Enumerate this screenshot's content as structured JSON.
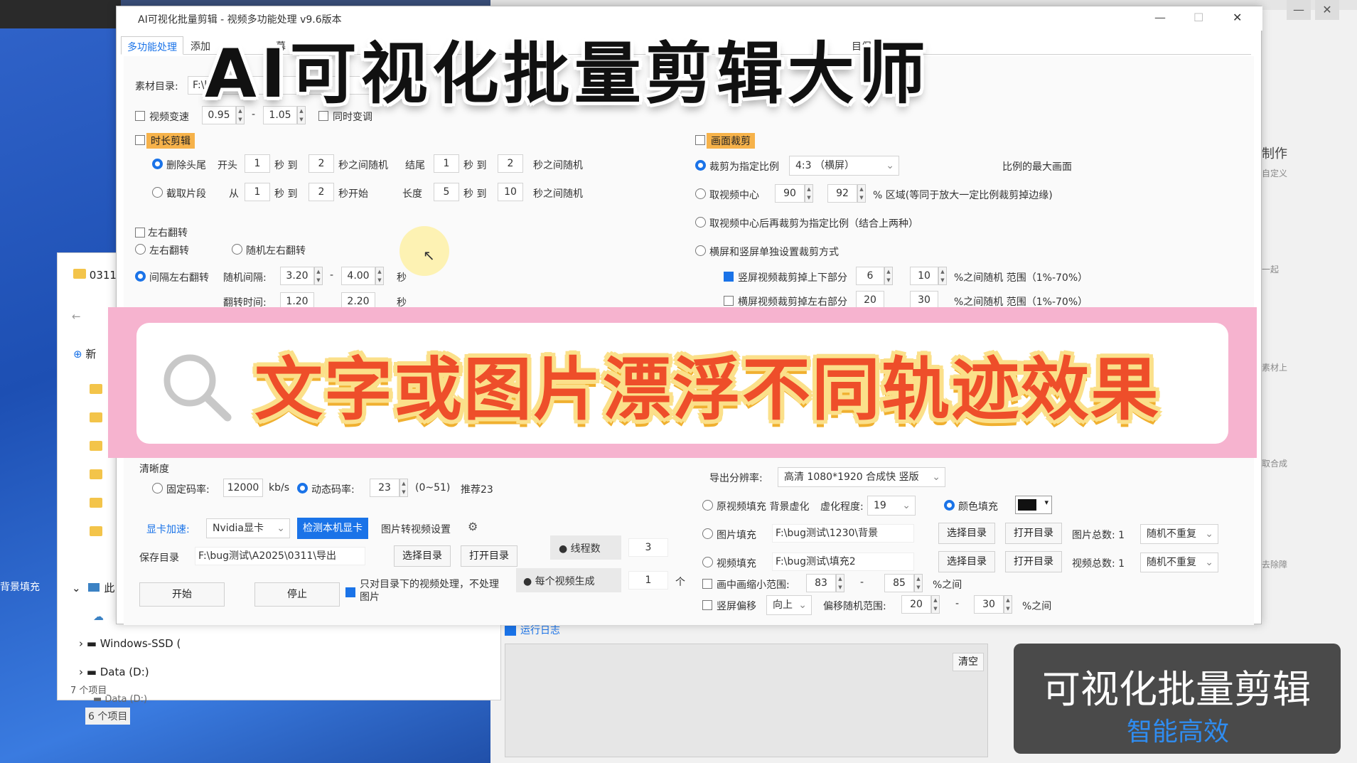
{
  "window": {
    "title": "AI可视化批量剪辑 - 视频多功能处理 v9.6版本",
    "minimize": "—",
    "maximize": "☐",
    "close": "✕"
  },
  "tabs": [
    "多功能处理",
    "添加",
    "幕",
    "卡",
    "目保存"
  ],
  "source": {
    "label": "素材目录:",
    "value": "F:\\b"
  },
  "speed": {
    "label": "视频变速",
    "min": "0.95",
    "dash": "-",
    "max": "1.05",
    "pitch_label": "同时变调"
  },
  "duration_cut": {
    "section_label": "时长剪辑",
    "row1": {
      "radio": "删除头尾",
      "start": "开头",
      "v1": "1",
      "to": "秒 到",
      "v2": "2",
      "rand": "秒之间随机",
      "end": "结尾",
      "v3": "1",
      "to2": "秒 到",
      "v4": "2",
      "rand2": "秒之间随机"
    },
    "row2": {
      "radio": "截取片段",
      "from": "从",
      "v1": "1",
      "to": "秒 到",
      "v2": "2",
      "begin": "秒开始",
      "len": "长度",
      "v3": "5",
      "to2": "秒 到",
      "v4": "10",
      "rand2": "秒之间随机"
    }
  },
  "flip": {
    "section_label": "左右翻转",
    "opt1": "左右翻转",
    "opt2": "随机左右翻转",
    "opt3": "间隔左右翻转",
    "interval_label": "随机间隔:",
    "i_min": "3.20",
    "dash": "-",
    "i_max": "4.00",
    "unit": "秒",
    "time_label": "翻转时间:",
    "t_min": "1.20",
    "t_max": "2.20"
  },
  "crop": {
    "section_label": "画面裁剪",
    "opt1": "裁剪为指定比例",
    "ratio": "4:3 （横屏）",
    "max_note": "比例的最大画面",
    "opt2": "取视频中心",
    "c1": "90",
    "c2": "92",
    "opt2_note": "% 区域(等同于放大一定比例裁剪掉边缘)",
    "opt3": "取视频中心后再裁剪为指定比例（结合上两种）",
    "opt4": "横屏和竖屏单独设置裁剪方式",
    "v_label": "竖屏视频裁剪掉上下部分",
    "v_min": "6",
    "v_max": "10",
    "v_note": "%之间随机 范围（1%-70%）",
    "h_label": "横屏视频裁剪掉左右部分",
    "h_min": "20",
    "h_max": "30",
    "h_note": "%之间随机 范围（1%-70%）",
    "dash": "-"
  },
  "quality": {
    "section_label": "清晰度",
    "fixed": "固定码率:",
    "bitrate": "12000",
    "unit": "kb/s",
    "dynamic": "动态码率:",
    "crf": "23",
    "range": "(0~51)",
    "recommend": "推荐23"
  },
  "gpu": {
    "label": "显卡加速:",
    "value": "Nvidia显卡",
    "detect": "检测本机显卡",
    "img_setting": "图片转视频设置"
  },
  "save": {
    "label": "保存目录",
    "path": "F:\\bug测试\\A2025\\0311\\导出",
    "choose": "选择目录",
    "open": "打开目录"
  },
  "threads": {
    "label": "线程数",
    "value": "3"
  },
  "per_video": {
    "label": "每个视频生成",
    "value": "1",
    "unit": "个"
  },
  "actions": {
    "start": "开始",
    "stop": "停止",
    "only_dir": "只对目录下的视频处理，不处理图片"
  },
  "export": {
    "res_label": "导出分辨率:",
    "res_value": "高清 1080*1920 合成快 竖版",
    "blur_fill": "原视频填充 背景虚化",
    "blur_level_label": "虚化程度:",
    "blur_level": "19",
    "color_fill": "颜色填充",
    "img_fill": "图片填充",
    "img_path": "F:\\bug测试\\1230\\背景",
    "choose": "选择目录",
    "open": "打开目录",
    "img_total": "图片总数: 1",
    "mode1": "随机不重复",
    "vid_fill": "视频填充",
    "vid_path": "F:\\bug测试\\填充2",
    "vid_total": "视频总数: 1",
    "mode2": "随机不重复",
    "pip_label": "画中画缩小范围:",
    "pip_min": "83",
    "pip_max": "85",
    "pip_note": "%之间",
    "offset_label": "竖屏偏移",
    "offset_dir": "向上",
    "offset_range_label": "偏移随机范围:",
    "off_min": "20",
    "off_max": "30",
    "off_note": "%之间",
    "dash": "-"
  },
  "overlay": {
    "headline": "AI可视化批量剪辑大师",
    "banner": "文字或图片漂浮不同轨迹效果"
  },
  "promo": {
    "title": "可视化批量剪辑",
    "subtitle": "智能高效"
  },
  "background": {
    "log_label": "运行日志",
    "clear": "清空",
    "side_1": "制作",
    "side_2": "自定义",
    "side_3": "一起",
    "side_4": "素材上",
    "side_5": "取合成",
    "side_6": "去除障",
    "bg_fill": "背景填充",
    "explorer_folder": "0311",
    "explorer_new": "新",
    "explorer_this": "此",
    "drive1": "Windows-SSD (",
    "drive2": "Data (D:)",
    "drive3": "Data (D:)",
    "count1": "7 个项目",
    "count2": "6 个项目"
  }
}
